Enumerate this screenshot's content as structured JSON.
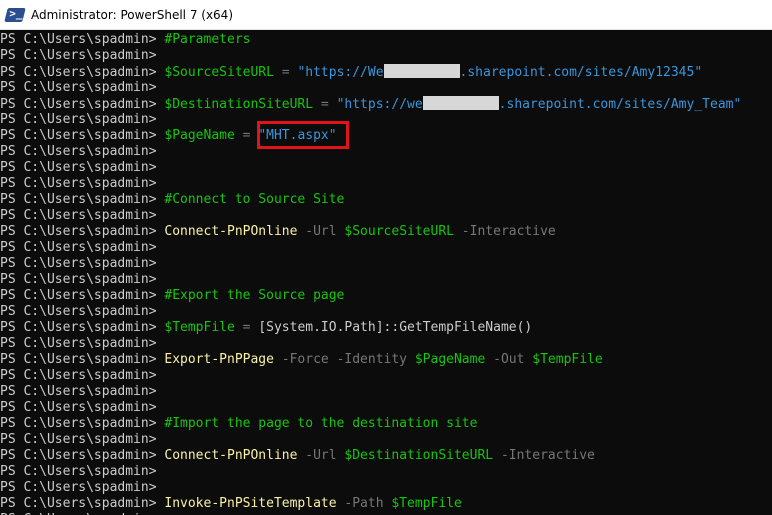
{
  "window": {
    "title": "Administrator: PowerShell 7 (x64)",
    "app_icon": "powershell-icon",
    "icon_glyph": ">_"
  },
  "prompt": "PS C:\\Users\\spadmin> ",
  "colors": {
    "background": "#0c0c0c",
    "comment": "#16c60c",
    "variable": "#16c60c",
    "string": "#3a96dd",
    "command": "#f9f1a5",
    "parameter": "#767676",
    "highlight": "#e0151b"
  },
  "lines": [
    {
      "tokens": [
        {
          "t": "comment",
          "v": "#Parameters"
        }
      ]
    },
    {
      "tokens": []
    },
    {
      "tokens": [
        {
          "t": "var",
          "v": "$SourceSiteURL"
        },
        {
          "t": "op",
          "v": " = "
        },
        {
          "t": "str",
          "v": "\"https://We"
        },
        {
          "t": "redact",
          "v": "",
          "w": 76
        },
        {
          "t": "str",
          "v": ".sharepoint.com/sites/Amy12345\""
        }
      ]
    },
    {
      "tokens": []
    },
    {
      "tokens": [
        {
          "t": "var",
          "v": "$DestinationSiteURL"
        },
        {
          "t": "op",
          "v": " = "
        },
        {
          "t": "str",
          "v": "\"https://we"
        },
        {
          "t": "redact",
          "v": "",
          "w": 76
        },
        {
          "t": "str",
          "v": ".sharepoint.com/sites/Amy_Team\""
        }
      ]
    },
    {
      "tokens": []
    },
    {
      "tokens": [
        {
          "t": "var",
          "v": "$PageName"
        },
        {
          "t": "op",
          "v": " = "
        },
        {
          "t": "str",
          "v": "\"MHT.aspx\""
        }
      ]
    },
    {
      "tokens": []
    },
    {
      "tokens": []
    },
    {
      "tokens": []
    },
    {
      "tokens": [
        {
          "t": "comment",
          "v": "#Connect to Source Site"
        }
      ]
    },
    {
      "tokens": []
    },
    {
      "tokens": [
        {
          "t": "cmd",
          "v": "Connect-PnPOnline"
        },
        {
          "t": "param",
          "v": " -Url "
        },
        {
          "t": "var",
          "v": "$SourceSiteURL"
        },
        {
          "t": "param",
          "v": " -Interactive"
        }
      ]
    },
    {
      "tokens": []
    },
    {
      "tokens": []
    },
    {
      "tokens": []
    },
    {
      "tokens": [
        {
          "t": "comment",
          "v": "#Export the Source page"
        }
      ]
    },
    {
      "tokens": []
    },
    {
      "tokens": [
        {
          "t": "var",
          "v": "$TempFile"
        },
        {
          "t": "op",
          "v": " = "
        },
        {
          "t": "plain",
          "v": "[System.IO.Path]::GetTempFileName()"
        }
      ]
    },
    {
      "tokens": []
    },
    {
      "tokens": [
        {
          "t": "cmd",
          "v": "Export-PnPPage"
        },
        {
          "t": "param",
          "v": " -Force -Identity "
        },
        {
          "t": "var",
          "v": "$PageName"
        },
        {
          "t": "param",
          "v": " -Out "
        },
        {
          "t": "var",
          "v": "$TempFile"
        }
      ]
    },
    {
      "tokens": []
    },
    {
      "tokens": []
    },
    {
      "tokens": []
    },
    {
      "tokens": [
        {
          "t": "comment",
          "v": "#Import the page to the destination site"
        }
      ]
    },
    {
      "tokens": []
    },
    {
      "tokens": [
        {
          "t": "cmd",
          "v": "Connect-PnPOnline"
        },
        {
          "t": "param",
          "v": " -Url "
        },
        {
          "t": "var",
          "v": "$DestinationSiteURL"
        },
        {
          "t": "param",
          "v": " -Interactive"
        }
      ]
    },
    {
      "tokens": []
    },
    {
      "tokens": []
    },
    {
      "tokens": [
        {
          "t": "cmd",
          "v": "Invoke-PnPSiteTemplate"
        },
        {
          "t": "param",
          "v": " -Path "
        },
        {
          "t": "var",
          "v": "$TempFile"
        }
      ]
    },
    {
      "tokens": []
    }
  ]
}
